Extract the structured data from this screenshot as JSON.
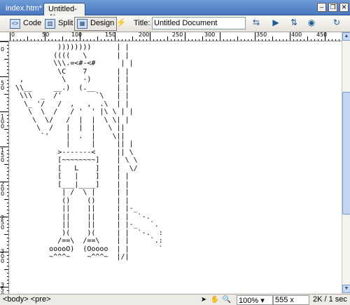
{
  "tabs": [
    {
      "label": "index.htm*"
    },
    {
      "label": "Untitled-4*"
    }
  ],
  "window_controls": {
    "minimize": "–",
    "restore": "❐",
    "close": "✕"
  },
  "toolbar": {
    "code_label": "Code",
    "split_label": "Split",
    "design_label": "Design",
    "title_label": "Title:",
    "title_value": "Untitled Document"
  },
  "ruler": {
    "h_marks": [
      "0",
      "50",
      "100",
      "150",
      "200",
      "250",
      "300",
      "350",
      "400",
      "450",
      "500"
    ],
    "v_marks": [
      "0",
      "50",
      "100",
      "150",
      "200",
      "250",
      "300",
      "350",
      "400"
    ]
  },
  "document": {
    "art": "           ))))))))      | |\n          ((((   \\       | |\n          \\\\\\.=<#-<#      | |\n           \\C    7       | |\n  ,         \\    -)      | |\n \\\\__     __.)  (.__     | |\n  \\\\\\  _  /'        `\\   | |\n   \\_ '/   /  ,   ,  .\\  | |\n    \\  \\  /   / '  ' |\\ \\ | |\n     \\  \\/   /  |  |  \\ \\| |\n      \\  /   |  |  |   \\ ||\n       `'    |  .  |    \\||\n             |     |     || |\n           >-------<     || \\\n           [~~~~~~~~]    | \\ \\\n           [   L    ]    |  \\/\n           [   |    ]    | |\n           [___|____]    | |\n            | /  \\ |     | |\n            ()    ()     | |\n            ||    ||     | |-_\n            ||    ||     | |  `-.\n            ||    ||     | |-_   `.\n            )(    )(     | |  `-.  :\n           /==\\  /==\\    | |     `.:\n         ooooO)  (Ooooo  | |       `\n         ~^^^~    ~^^^~  |/|"
  },
  "statusbar": {
    "tags": "<body> <pre>",
    "zoom": "100%",
    "size": "555 x 410",
    "download": "2K / 1 sec"
  },
  "icons": {
    "code": "code-view-icon",
    "split": "split-view-icon",
    "design": "design-view-icon",
    "live": "live-view-icon",
    "preview": "preview-browser-icon",
    "debug": "debug-icon",
    "refresh": "refresh-icon"
  }
}
